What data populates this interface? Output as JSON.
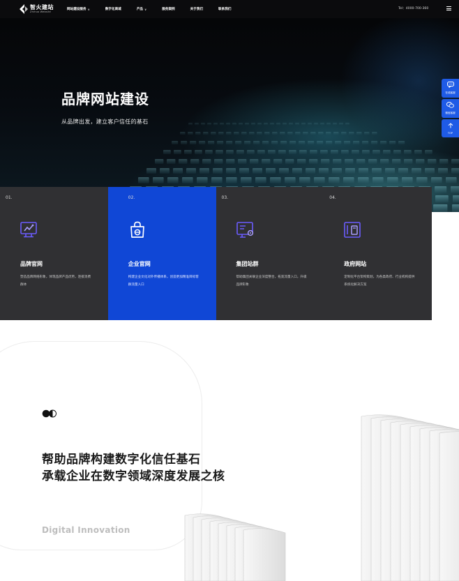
{
  "header": {
    "logo_cn": "智火建站",
    "logo_en": "Zhihuo Website",
    "nav": [
      {
        "label": "网站建设服务",
        "caret": "∨"
      },
      {
        "label": "数字化商城",
        "caret": ""
      },
      {
        "label": "产品",
        "caret": "∨"
      },
      {
        "label": "服务案例",
        "caret": ""
      },
      {
        "label": "关于我们",
        "caret": ""
      },
      {
        "label": "联系我们",
        "caret": ""
      }
    ],
    "tel": "Tel：4000-700-360",
    "menu_icon": "hamburger-menu-icon"
  },
  "hero": {
    "title": "品牌网站建设",
    "subtitle": "从品牌出发，建立客户信任的基石"
  },
  "float": {
    "items": [
      {
        "icon": "chat-bubble-icon",
        "label": "在线客服"
      },
      {
        "icon": "wechat-icon",
        "label": "微信客服"
      },
      {
        "icon": "arrow-up-icon",
        "label": "TOP"
      }
    ]
  },
  "cards": [
    {
      "no": "01.",
      "title": "品牌官网",
      "desc": "塑造品牌网络形象，体现品牌产品优势，连接消费群体",
      "icon": "monitor-chart-icon",
      "active": false
    },
    {
      "no": "02.",
      "title": "企业官网",
      "desc": "构建企业文化对外传播体系，创造更加精准目标客群流量入口",
      "icon": "shopping-bag-e-icon",
      "active": true
    },
    {
      "no": "03.",
      "title": "集团站群",
      "desc": "帮助集团关联企业深度整合，拓宽流量入口，升级品牌形象",
      "icon": "screen-settings-icon",
      "active": false
    },
    {
      "no": "04.",
      "title": "政府网站",
      "desc": "定制化平台架构策划，为各类政府、行业机构提供系统化解决方案",
      "icon": "device-layout-icon",
      "active": false
    }
  ],
  "lower": {
    "slogan_line1": "帮助品牌构建数字化信任基石",
    "slogan_line2": "承载企业在数字领域深度发展之核",
    "english": "Digital Innovation"
  },
  "colors": {
    "header_bg": "#0b0b0d",
    "card_bg": "#303033",
    "card_active": "#1047d6",
    "float_blue": "#1f5be6",
    "icon_purple": "#6b5cff"
  }
}
